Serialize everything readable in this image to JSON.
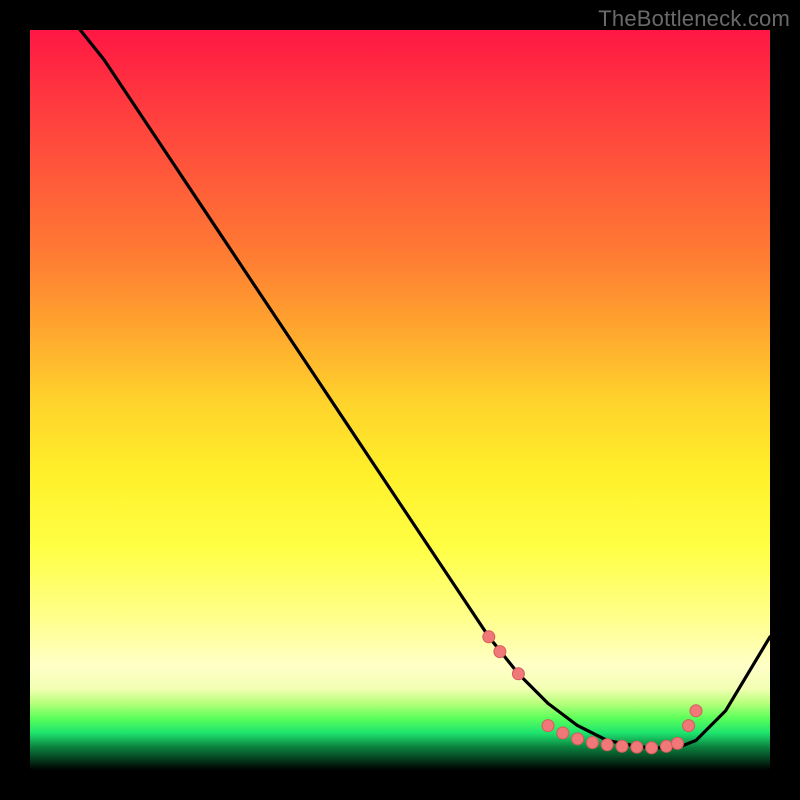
{
  "watermark": "TheBottleneck.com",
  "colors": {
    "frame_bg": "#000000",
    "watermark_text": "#6a6a6a",
    "curve_stroke": "#000000",
    "marker_fill": "#f07878",
    "marker_stroke": "#d85a5a"
  },
  "chart_data": {
    "type": "line",
    "title": "",
    "xlabel": "",
    "ylabel": "",
    "xlim": [
      0,
      100
    ],
    "ylim": [
      0,
      100
    ],
    "grid": false,
    "legend": false,
    "series": [
      {
        "name": "curve",
        "x": [
          0,
          2,
          6,
          10,
          14,
          18,
          22,
          26,
          30,
          34,
          38,
          42,
          46,
          50,
          54,
          58,
          62,
          66,
          70,
          74,
          78,
          82,
          84,
          86,
          88,
          90,
          94,
          100
        ],
        "y": [
          108,
          105,
          101,
          96,
          90,
          84,
          78,
          72,
          66,
          60,
          54,
          48,
          42,
          36,
          30,
          24,
          18,
          13,
          9,
          6,
          4,
          3.2,
          3.0,
          3.0,
          3.2,
          4,
          8,
          18
        ]
      }
    ],
    "markers": [
      {
        "x": 62,
        "y": 18
      },
      {
        "x": 63.5,
        "y": 16
      },
      {
        "x": 66,
        "y": 13
      },
      {
        "x": 70,
        "y": 6
      },
      {
        "x": 72,
        "y": 5
      },
      {
        "x": 74,
        "y": 4.2
      },
      {
        "x": 76,
        "y": 3.7
      },
      {
        "x": 78,
        "y": 3.4
      },
      {
        "x": 80,
        "y": 3.2
      },
      {
        "x": 82,
        "y": 3.1
      },
      {
        "x": 84,
        "y": 3.0
      },
      {
        "x": 86,
        "y": 3.2
      },
      {
        "x": 87.5,
        "y": 3.6
      },
      {
        "x": 89,
        "y": 6
      },
      {
        "x": 90,
        "y": 8
      }
    ]
  }
}
